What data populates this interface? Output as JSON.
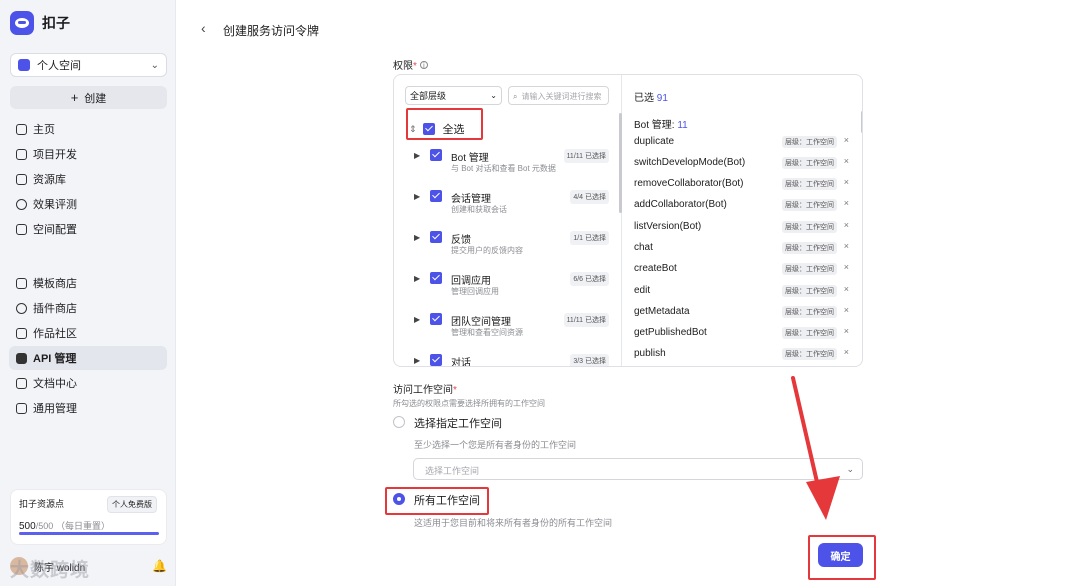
{
  "sidebar": {
    "brand": "扣子",
    "space": "个人空间",
    "create": "创建",
    "nav_top": [
      {
        "label": "主页"
      },
      {
        "label": "项目开发"
      },
      {
        "label": "资源库"
      },
      {
        "label": "效果评测"
      },
      {
        "label": "空间配置"
      }
    ],
    "nav_bottom": [
      {
        "label": "模板商店"
      },
      {
        "label": "插件商店"
      },
      {
        "label": "作品社区"
      },
      {
        "label": "API 管理"
      },
      {
        "label": "文档中心"
      },
      {
        "label": "通用管理"
      }
    ],
    "resource": {
      "title": "扣子资源点",
      "badge": "个人免费版",
      "value": "500",
      "total": "/500",
      "note": "（每日重置）",
      "used_fraction": 1.0
    },
    "user": "陈宇 wolidn",
    "watermark": "大数跨境"
  },
  "header": {
    "back": "‹",
    "title": "创建服务访问令牌"
  },
  "permissions": {
    "label": "权限",
    "required": "*",
    "level_select": "全部层级",
    "search_placeholder": "请输入关键词进行搜索",
    "select_all": "全选",
    "groups": [
      {
        "name": "Bot 管理",
        "desc": "与 Bot 对话和查看 Bot 元数据",
        "count": "11/11 已选择"
      },
      {
        "name": "会话管理",
        "desc": "创建和获取会话",
        "count": "4/4 已选择"
      },
      {
        "name": "反馈",
        "desc": "提交用户的反馈内容",
        "count": "1/1 已选择"
      },
      {
        "name": "回调应用",
        "desc": "管理回调应用",
        "count": "6/6 已选择"
      },
      {
        "name": "团队空间管理",
        "desc": "管理和查看空间资源",
        "count": "11/11 已选择"
      },
      {
        "name": "对话",
        "desc": "",
        "count": "3/3 已选择"
      }
    ],
    "selected_label": "已选",
    "selected_count": "91",
    "sub_head": "Bot 管理:",
    "sub_count": "11",
    "items": [
      {
        "name": "duplicate",
        "level": "层级：工作空间"
      },
      {
        "name": "switchDevelopMode(Bot)",
        "level": "层级：工作空间"
      },
      {
        "name": "removeCollaborator(Bot)",
        "level": "层级：工作空间"
      },
      {
        "name": "addCollaborator(Bot)",
        "level": "层级：工作空间"
      },
      {
        "name": "listVersion(Bot)",
        "level": "层级：工作空间"
      },
      {
        "name": "chat",
        "level": "层级：工作空间"
      },
      {
        "name": "createBot",
        "level": "层级：工作空间"
      },
      {
        "name": "edit",
        "level": "层级：工作空间"
      },
      {
        "name": "getMetadata",
        "level": "层级：工作空间"
      },
      {
        "name": "getPublishedBot",
        "level": "层级：工作空间"
      },
      {
        "name": "publish",
        "level": "层级：工作空间"
      }
    ]
  },
  "workspace": {
    "label": "访问工作空间",
    "required": "*",
    "desc": "所勾选的权限点需要选择所拥有的工作空间",
    "option1": "选择指定工作空间",
    "option1_desc": "至少选择一个您是所有者身份的工作空间",
    "select_placeholder": "选择工作空间",
    "option2": "所有工作空间",
    "option2_desc": "这适用于您目前和将来所有者身份的所有工作空间"
  },
  "confirm": "确定",
  "colors": {
    "accent": "#4d53e8",
    "highlight": "#e5383b"
  }
}
